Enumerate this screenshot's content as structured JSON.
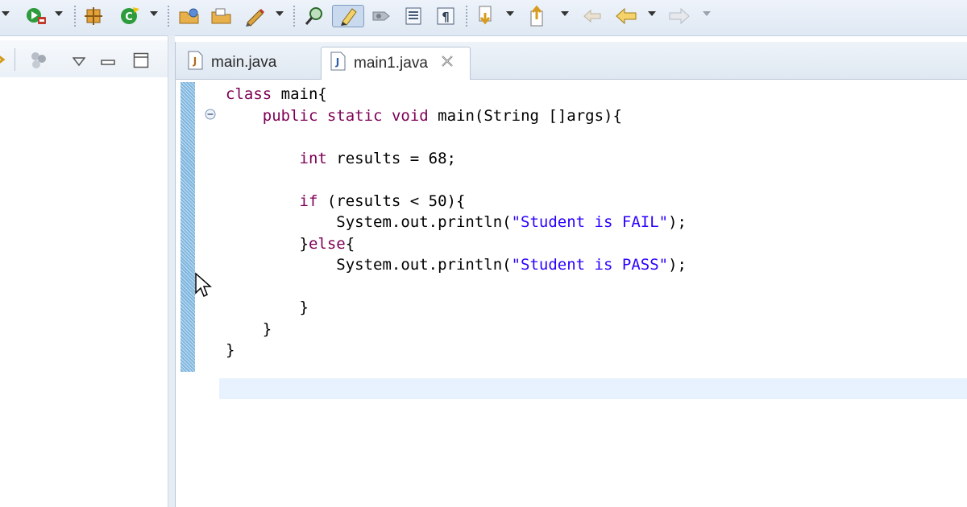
{
  "toolbar": {
    "icons": [
      "run-icon",
      "debug-icon",
      "new-class-icon",
      "refresh-icon",
      "open-folder-icon",
      "open-file-icon",
      "pencil-icon",
      "search-icon",
      "highlight-icon",
      "show-whitespace-icon",
      "toggle-block-icon",
      "paragraph-icon",
      "next-annotation-icon",
      "previous-annotation-icon",
      "back-icon",
      "forward-icon"
    ],
    "highlight_pressed": true
  },
  "tabs": [
    {
      "label": "main.java",
      "active": false,
      "icon": "java-file-icon"
    },
    {
      "label": "main1.java",
      "active": true,
      "icon": "java-file-icon",
      "close_icon": "close-icon"
    }
  ],
  "code": {
    "lines": [
      {
        "tokens": [
          {
            "t": "class",
            "kw": true
          },
          {
            "t": " main{"
          }
        ]
      },
      {
        "tokens": [
          {
            "t": "    "
          },
          {
            "t": "public",
            "kw": true
          },
          {
            "t": " "
          },
          {
            "t": "static",
            "kw": true
          },
          {
            "t": " "
          },
          {
            "t": "void",
            "kw": true
          },
          {
            "t": " main(String []args){"
          }
        ]
      },
      {
        "tokens": [
          {
            "t": ""
          }
        ]
      },
      {
        "tokens": [
          {
            "t": "        "
          },
          {
            "t": "int",
            "kw": true
          },
          {
            "t": " results = 68;"
          }
        ]
      },
      {
        "tokens": [
          {
            "t": ""
          }
        ]
      },
      {
        "tokens": [
          {
            "t": "        "
          },
          {
            "t": "if",
            "kw": true
          },
          {
            "t": " (results < 50){"
          }
        ]
      },
      {
        "tokens": [
          {
            "t": "            System.out.println("
          },
          {
            "t": "\"Student is FAIL\"",
            "str": true
          },
          {
            "t": ");"
          }
        ]
      },
      {
        "tokens": [
          {
            "t": "        }"
          },
          {
            "t": "else",
            "kw": true
          },
          {
            "t": "{"
          }
        ]
      },
      {
        "tokens": [
          {
            "t": "            System.out.println("
          },
          {
            "t": "\"Student is PASS\"",
            "str": true
          },
          {
            "t": ");"
          }
        ]
      },
      {
        "tokens": [
          {
            "t": ""
          }
        ]
      },
      {
        "tokens": [
          {
            "t": "        }"
          }
        ]
      },
      {
        "tokens": [
          {
            "t": "    }"
          }
        ]
      },
      {
        "tokens": [
          {
            "t": "}"
          }
        ]
      }
    ],
    "current_line": 13
  },
  "colors": {
    "keyword": "#7f0055",
    "string": "#2a00ff",
    "current_line": "#e8f2fe",
    "gutter": "#7fb6df"
  }
}
